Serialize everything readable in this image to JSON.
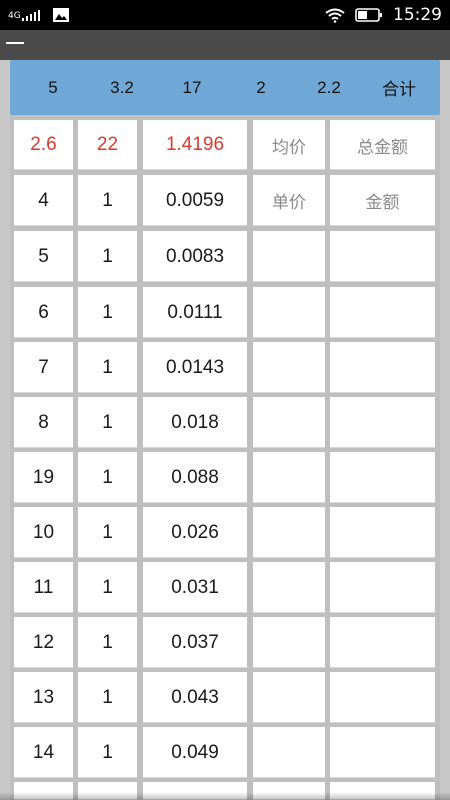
{
  "status_bar": {
    "network": "4G",
    "time": "15:29",
    "icons": [
      "signal-icon",
      "gallery-icon",
      "wifi-icon",
      "battery-icon"
    ]
  },
  "summary": [
    "5",
    "3.2",
    "17",
    "2",
    "2.2",
    "合计"
  ],
  "rows": [
    {
      "c1": "2.6",
      "c2": "22",
      "c3": "1.4196",
      "c4": "均价",
      "c5": "总金额"
    },
    {
      "c1": "4",
      "c2": "1",
      "c3": "0.0059",
      "c4": "单价",
      "c5": "金额"
    },
    {
      "c1": "5",
      "c2": "1",
      "c3": "0.0083",
      "c4": "",
      "c5": ""
    },
    {
      "c1": "6",
      "c2": "1",
      "c3": "0.0111",
      "c4": "",
      "c5": ""
    },
    {
      "c1": "7",
      "c2": "1",
      "c3": "0.0143",
      "c4": "",
      "c5": ""
    },
    {
      "c1": "8",
      "c2": "1",
      "c3": "0.018",
      "c4": "",
      "c5": ""
    },
    {
      "c1": "19",
      "c2": "1",
      "c3": "0.088",
      "c4": "",
      "c5": ""
    },
    {
      "c1": "10",
      "c2": "1",
      "c3": "0.026",
      "c4": "",
      "c5": ""
    },
    {
      "c1": "11",
      "c2": "1",
      "c3": "0.031",
      "c4": "",
      "c5": ""
    },
    {
      "c1": "12",
      "c2": "1",
      "c3": "0.037",
      "c4": "",
      "c5": ""
    },
    {
      "c1": "13",
      "c2": "1",
      "c3": "0.043",
      "c4": "",
      "c5": ""
    },
    {
      "c1": "14",
      "c2": "1",
      "c3": "0.049",
      "c4": "",
      "c5": ""
    },
    {
      "c1": "",
      "c2": "",
      "c3": "",
      "c4": "",
      "c5": ""
    }
  ],
  "colors": {
    "summary_bg": "#6fa8d6",
    "highlight_red": "#d93a2e",
    "label_gray": "#8a8a8a",
    "status_bg": "#000000",
    "header_bg": "#4a4a4a"
  }
}
